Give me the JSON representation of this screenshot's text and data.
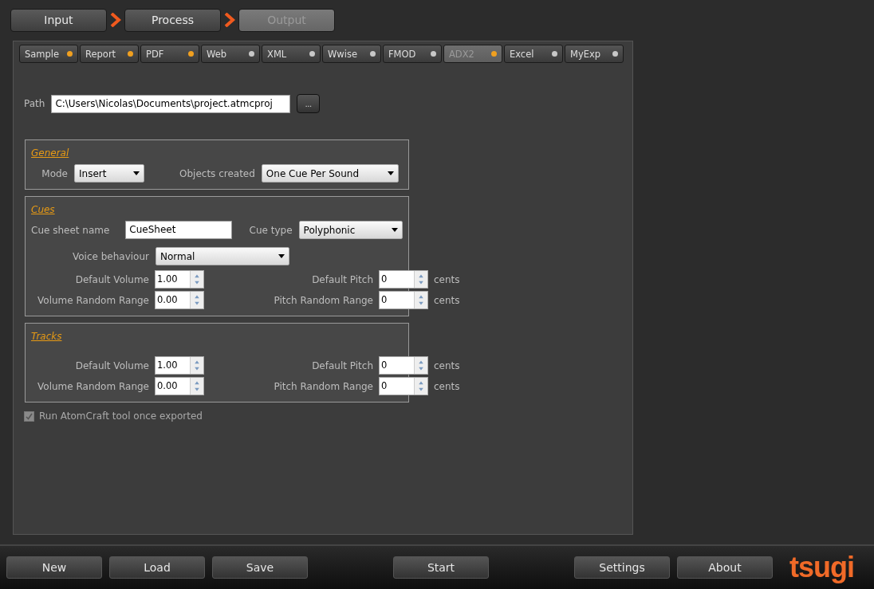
{
  "steps": [
    {
      "label": "Input",
      "selected": false
    },
    {
      "label": "Process",
      "selected": false
    },
    {
      "label": "Output",
      "selected": true
    }
  ],
  "tabs": [
    {
      "label": "Sample",
      "selected": false,
      "color": "#f0a020"
    },
    {
      "label": "Report",
      "selected": false,
      "color": "#f0a020"
    },
    {
      "label": "PDF",
      "selected": false,
      "color": "#f0a020"
    },
    {
      "label": "Web",
      "selected": false,
      "color": "#c8c8c8"
    },
    {
      "label": "XML",
      "selected": false,
      "color": "#c8c8c8"
    },
    {
      "label": "Wwise",
      "selected": false,
      "color": "#c8c8c8"
    },
    {
      "label": "FMOD",
      "selected": false,
      "color": "#c8c8c8"
    },
    {
      "label": "ADX2",
      "selected": true,
      "color": "#f0a020"
    },
    {
      "label": "Excel",
      "selected": false,
      "color": "#c8c8c8"
    },
    {
      "label": "MyExp",
      "selected": false,
      "color": "#c8c8c8"
    }
  ],
  "path": {
    "label": "Path",
    "value": "C:\\Users\\Nicolas\\Documents\\project.atmcproj",
    "browse": "..."
  },
  "general": {
    "title": "General",
    "mode": {
      "label": "Mode",
      "value": "Insert"
    },
    "objects": {
      "label": "Objects created",
      "value": "One Cue Per Sound"
    }
  },
  "cues": {
    "title": "Cues",
    "sheet": {
      "label": "Cue sheet name",
      "value": "CueSheet"
    },
    "type": {
      "label": "Cue type",
      "value": "Polyphonic"
    },
    "voice": {
      "label": "Voice behaviour",
      "value": "Normal"
    },
    "rows": [
      {
        "left_label": "Default Volume",
        "left_value": "1.00",
        "right_label": "Default Pitch",
        "right_value": "0",
        "unit": "cents"
      },
      {
        "left_label": "Volume Random Range",
        "left_value": "0.00",
        "right_label": "Pitch Random Range",
        "right_value": "0",
        "unit": "cents"
      }
    ]
  },
  "tracks": {
    "title": "Tracks",
    "rows": [
      {
        "left_label": "Default Volume",
        "left_value": "1.00",
        "right_label": "Default Pitch",
        "right_value": "0",
        "unit": "cents"
      },
      {
        "left_label": "Volume Random Range",
        "left_value": "0.00",
        "right_label": "Pitch Random Range",
        "right_value": "0",
        "unit": "cents"
      }
    ]
  },
  "run_tool": {
    "label": "Run AtomCraft tool once exported",
    "checked": true,
    "disabled": true
  },
  "footer": {
    "left": [
      "New",
      "Load",
      "Save"
    ],
    "center": [
      "Start"
    ],
    "right": [
      "Settings",
      "About"
    ],
    "logo": "tsugi"
  }
}
